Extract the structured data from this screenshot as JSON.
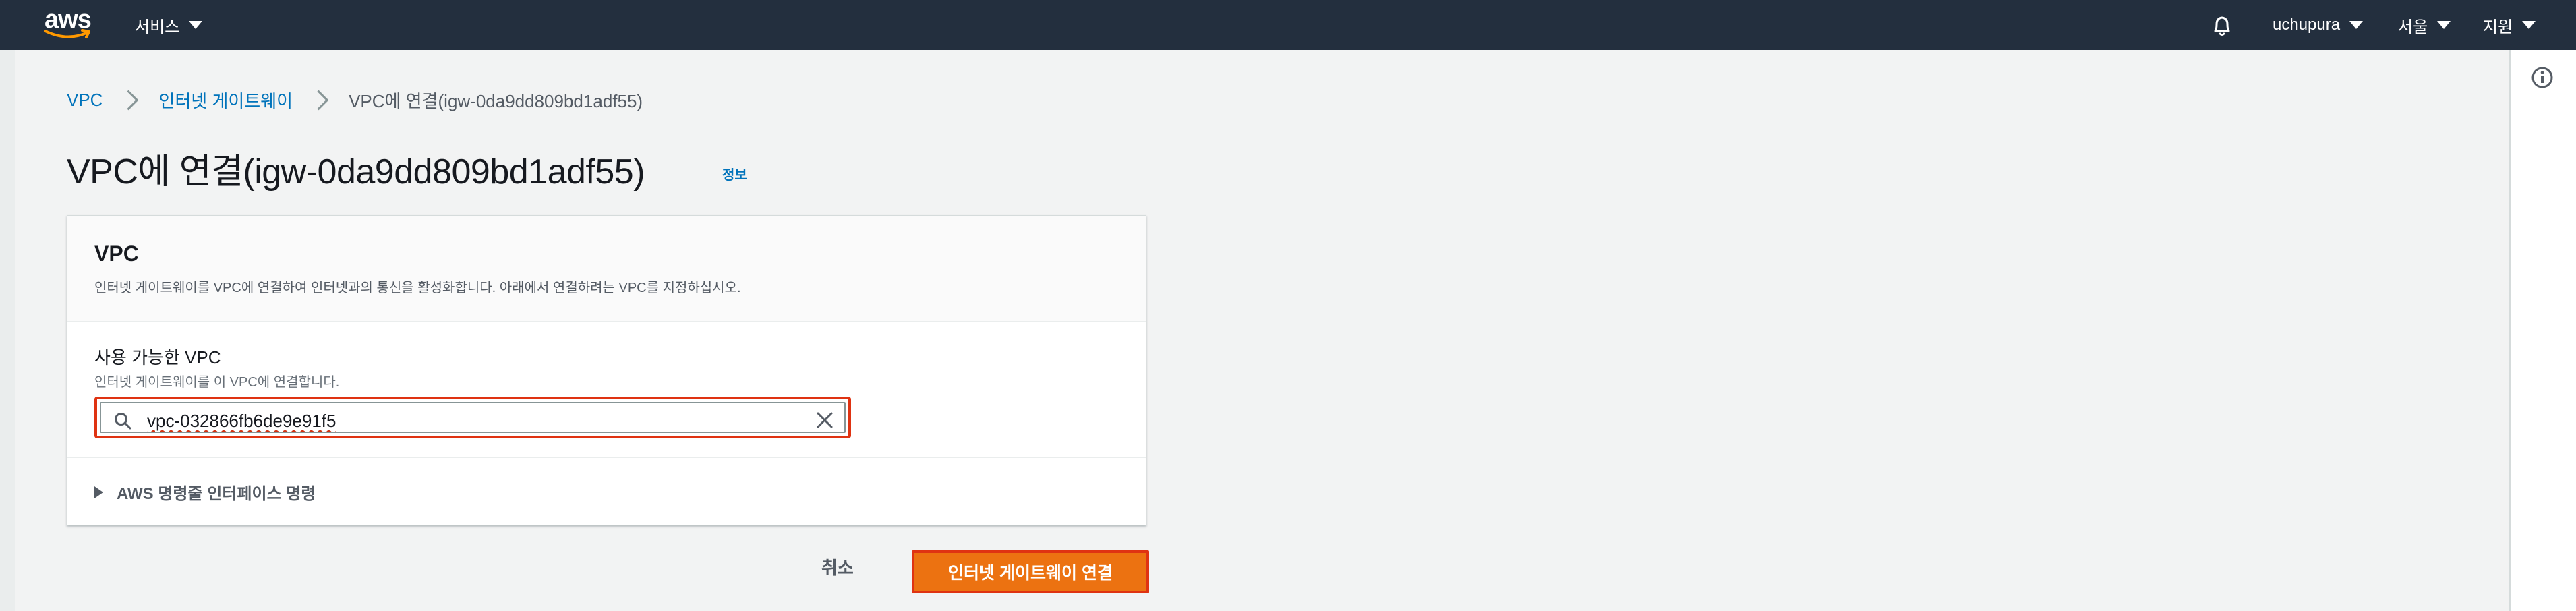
{
  "topnav": {
    "logo": "aws",
    "services_label": "서비스",
    "bell_icon": "bell-icon",
    "user_label": "uchupura",
    "region_label": "서울",
    "support_label": "지원"
  },
  "breadcrumb": {
    "items": [
      "VPC",
      "인터넷 게이트웨이"
    ],
    "current": "VPC에 연결(igw-0da9dd809bd1adf55)"
  },
  "page": {
    "title": "VPC에 연결(igw-0da9dd809bd1adf55)",
    "info_link": "정보"
  },
  "container": {
    "title": "VPC",
    "description": "인터넷 게이트웨이를 VPC에 연결하여 인터넷과의 통신을 활성화합니다. 아래에서 연결하려는 VPC를 지정하십시오.",
    "field_label": "사용 가능한 VPC",
    "field_description": "인터넷 게이트웨이를 이 VPC에 연결합니다.",
    "vpc_value": "vpc-032866fb6de9e91f5",
    "cli_expander": "AWS 명령줄 인터페이스 명령"
  },
  "actions": {
    "cancel": "취소",
    "submit": "인터넷 게이트웨이 연결"
  },
  "colors": {
    "nav_bg": "#232f3e",
    "link": "#0073bb",
    "primary": "#ec7211",
    "highlight_border": "#df3312"
  }
}
